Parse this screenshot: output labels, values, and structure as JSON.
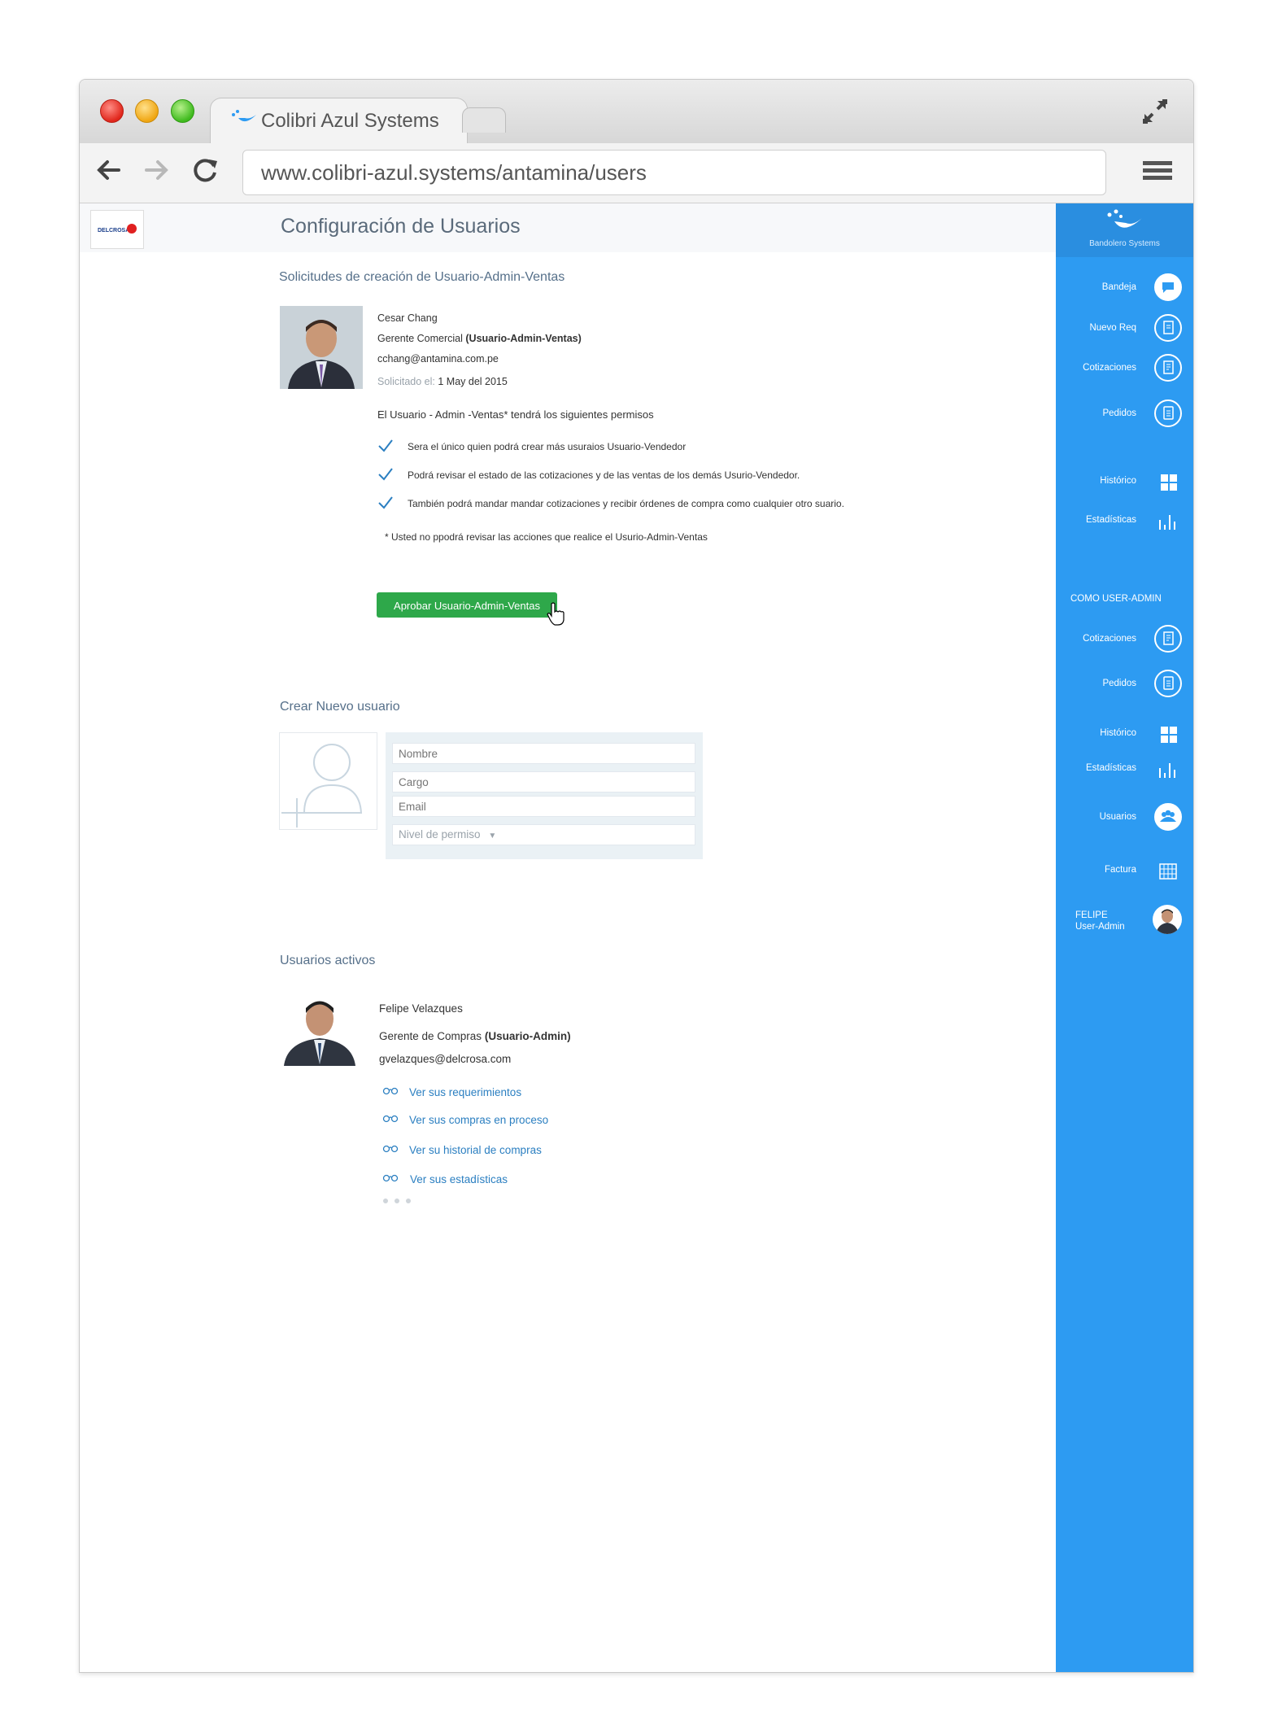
{
  "browser": {
    "tab_title": "Colibri Azul Systems",
    "url": "www.colibri-azul.systems/antamina/users"
  },
  "header": {
    "logo_text": "DELCROSA",
    "page_title": "Configuración de Usuarios"
  },
  "requests": {
    "section_title": "Solicitudes de creación de Usuario-Admin-Ventas",
    "name": "Cesar Chang",
    "role_prefix": "Gerente Comercial",
    "role_bold": "(Usuario-Admin-Ventas)",
    "email": "cchang@antamina.com.pe",
    "requested_label": "Solicitado el:",
    "requested_date": "1 May del 2015",
    "permissions_intro": "El Usuario - Admin -Ventas* tendrá los siguientes permisos",
    "permissions": [
      "Sera el único quien podrá crear más usuraios Usuario-Vendedor",
      "Podrá revisar el estado de las cotizaciones y de las ventas de los demás Usurio-Vendedor.",
      "También podrá mandar mandar cotizaciones y recibir órdenes de compra como cualquier otro suario."
    ],
    "note": "* Usted no ppodrá revisar las acciones que realice el Usurio-Admin-Ventas",
    "approve_button": "Aprobar Usuario-Admin-Ventas"
  },
  "new_user": {
    "section_title": "Crear Nuevo usuario",
    "name_placeholder": "Nombre",
    "cargo_placeholder": "Cargo",
    "email_placeholder": "Email",
    "permission_placeholder": "Nivel de permiso"
  },
  "active_users": {
    "section_title": "Usuarios activos",
    "name": "Felipe Velazques",
    "role_prefix": "Gerente de Compras",
    "role_bold": "(Usuario-Admin)",
    "email": "gvelazques@delcrosa.com",
    "links": [
      "Ver sus requerimientos",
      "Ver sus compras en proceso",
      "Ver su historial de compras",
      "Ver sus estadísticas"
    ]
  },
  "sidebar": {
    "brand": "Bandolero Systems",
    "items": [
      {
        "label": "Bandeja",
        "icon": "chat-icon"
      },
      {
        "label": "Nuevo Req",
        "icon": "new-request-icon"
      },
      {
        "label": "Cotizaciones",
        "icon": "quote-icon"
      },
      {
        "label": "Pedidos",
        "icon": "orders-icon"
      },
      {
        "label": "Histórico",
        "icon": "grid-icon"
      },
      {
        "label": "Estadísticas",
        "icon": "bar-chart-icon"
      }
    ],
    "admin_section": "COMO USER-ADMIN",
    "admin_items": [
      {
        "label": "Cotizaciones",
        "icon": "quote-icon"
      },
      {
        "label": "Pedidos",
        "icon": "orders-icon"
      },
      {
        "label": "Histórico",
        "icon": "grid-icon"
      },
      {
        "label": "Estadísticas",
        "icon": "bar-chart-icon"
      },
      {
        "label": "Usuarios",
        "icon": "users-icon"
      },
      {
        "label": "Factura",
        "icon": "invoice-icon"
      }
    ],
    "profile": {
      "name": "FELIPE",
      "role": "User-Admin"
    }
  },
  "colors": {
    "sidebar": "#2d9bf2",
    "approve": "#2ea84a",
    "link": "#2b7fc1"
  }
}
